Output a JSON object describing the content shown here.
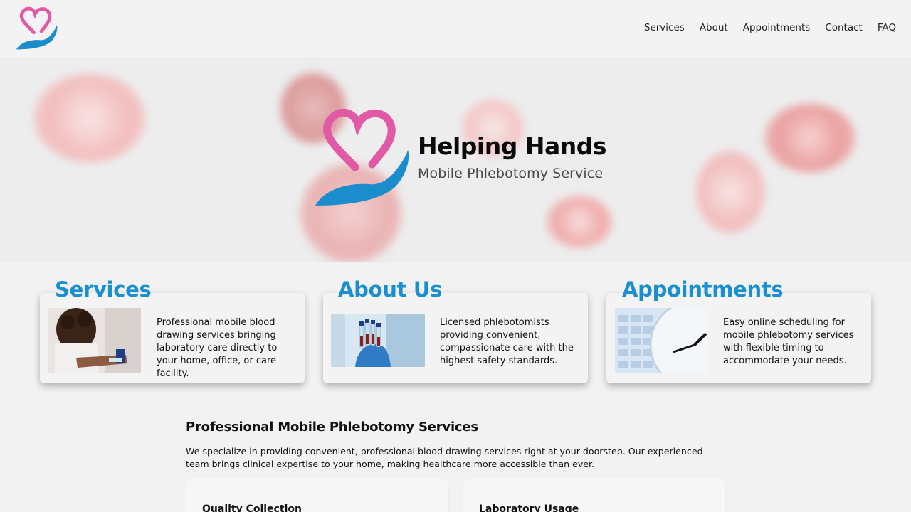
{
  "nav": {
    "items": [
      "Services",
      "About",
      "Appointments",
      "Contact",
      "FAQ"
    ]
  },
  "hero": {
    "title": "Helping Hands",
    "subtitle": "Mobile Phlebotomy Service"
  },
  "features": [
    {
      "title": "Services",
      "text": "Professional mobile blood drawing services bringing laboratory care directly to your home, office, or care facility.",
      "image": "blood-draw-photo"
    },
    {
      "title": "About Us",
      "text": "Licensed phlebotomists providing convenient, compassionate care with the highest safety standards.",
      "image": "blood-tubes-photo"
    },
    {
      "title": "Appointments",
      "text": "Easy online scheduling for mobile phlebotomy services with flexible timing to accommodate your needs.",
      "image": "calendar-clock-photo"
    }
  ],
  "content": {
    "title": "Professional Mobile Phlebotomy Services",
    "paragraph": "We specialize in providing convenient, professional blood drawing services right at your doorstep. Our experienced team brings clinical expertise to your home, making healthcare more accessible than ever.",
    "cards": [
      "Quality Collection",
      "Laboratory Usage"
    ]
  },
  "colors": {
    "accent": "#1a8fd0",
    "heart": "#e05aa6",
    "hand": "#1b8ccc",
    "background": "#f2f2f2"
  },
  "icons": {
    "logo": "heart-hand-logo-icon"
  }
}
